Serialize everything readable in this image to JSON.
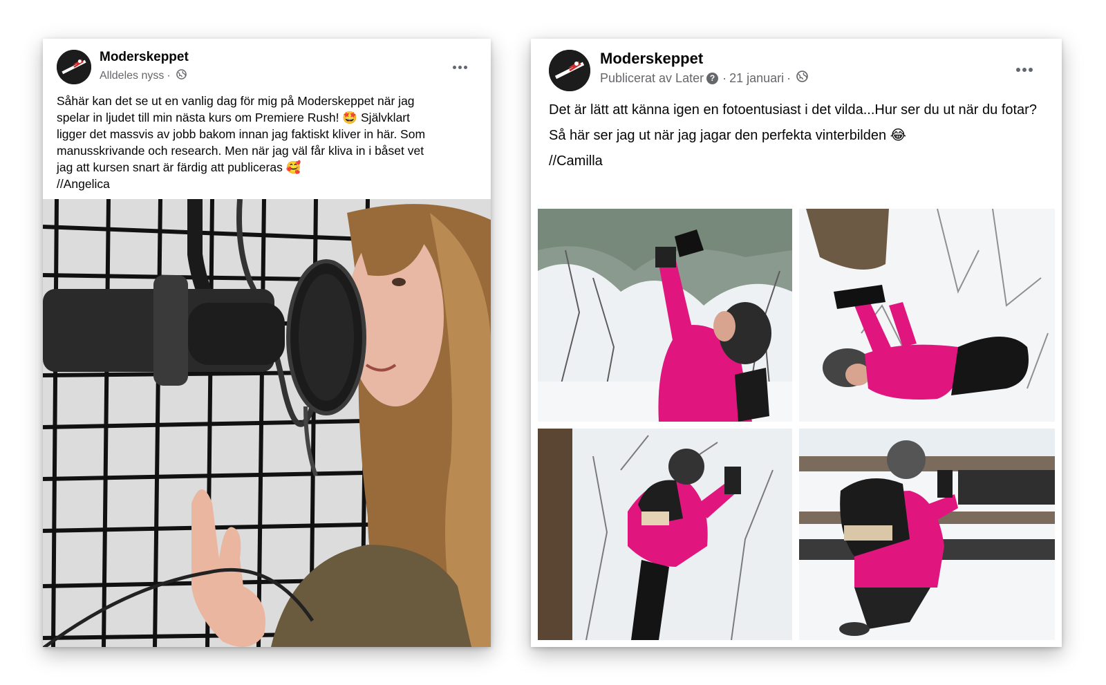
{
  "posts": [
    {
      "page_name": "Moderskeppet",
      "timestamp": "Alldeles nyss",
      "privacy": "public",
      "text_lines": [
        "Såhär kan det se ut en vanlig dag för mig på Moderskeppet när jag",
        "spelar in ljudet till min nästa kurs om Premiere Rush! 🤩 Självklart",
        "ligger det massvis av jobb bakom innan jag faktiskt kliver in här. Som",
        "manusskrivande och research. Men när jag väl får kliva in i båset vet",
        "jag att kursen snart är färdig att publiceras 🥰",
        "//Angelica"
      ],
      "image": "woman-recording-at-microphone"
    },
    {
      "page_name": "Moderskeppet",
      "published_by": "Publicerat av Later",
      "date": "21 januari",
      "privacy": "public",
      "paragraphs": [
        "Det är lätt att känna igen en fotoentusiast i det vilda...Hur ser du ut när du fotar?",
        "Så här ser jag ut när jag jagar den perfekta vinterbilden 😂",
        "//Camilla"
      ],
      "images": [
        "photographer-standing-in-snow",
        "photographer-lying-in-snow",
        "photographer-crouching-in-snowy-forest",
        "photographer-kneeling-by-fence"
      ]
    }
  ],
  "colors": {
    "text": "#050505",
    "meta": "#65676b",
    "jacket": "#e0167e"
  },
  "icons": {
    "globe": "globe-icon",
    "more": "more-options-icon",
    "help": "help-icon"
  },
  "dot_separator": "·",
  "help_glyph": "?"
}
